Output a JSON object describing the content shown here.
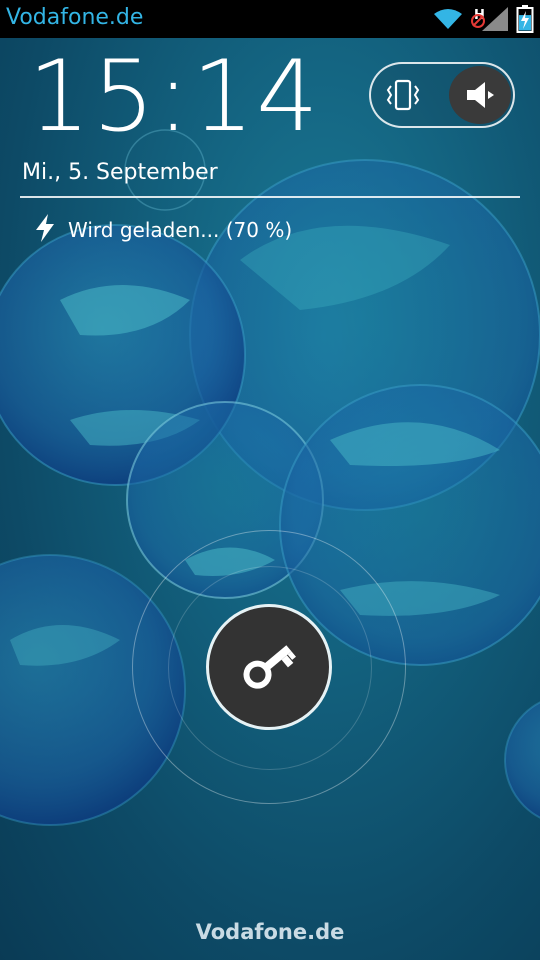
{
  "status_bar": {
    "carrier": "Vodafone.de",
    "icons": [
      "wifi-icon",
      "no-sim-signal-icon",
      "battery-charging-icon"
    ]
  },
  "lockscreen": {
    "time": "15:14",
    "date": "Mi., 5. September",
    "charging_status": "Wird geladen... (70 %)",
    "battery_level_percent": 70,
    "sound_mode": "sound",
    "carrier_footer": "Vodafone.de"
  },
  "colors": {
    "accent": "#33b5e5",
    "status_bar_bg": "#000000",
    "handle_bg": "#333333"
  }
}
